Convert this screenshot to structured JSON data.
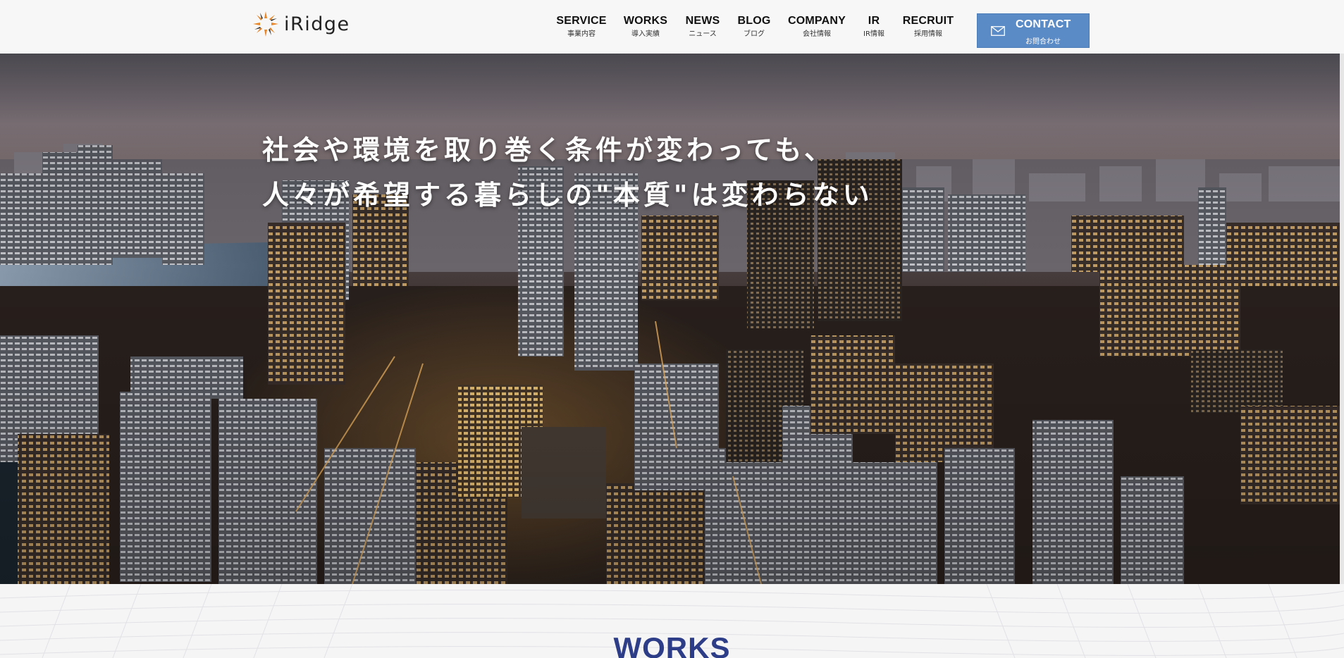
{
  "header": {
    "logo_text": "iRidge",
    "logo_icon": "sunburst-logo-icon",
    "brand_color": "#e8862a",
    "nav": [
      {
        "en": "SERVICE",
        "ja": "事業内容"
      },
      {
        "en": "WORKS",
        "ja": "導入実績"
      },
      {
        "en": "NEWS",
        "ja": "ニュース"
      },
      {
        "en": "BLOG",
        "ja": "ブログ"
      },
      {
        "en": "COMPANY",
        "ja": "会社情報"
      },
      {
        "en": "IR",
        "ja": "IR情報"
      },
      {
        "en": "RECRUIT",
        "ja": "採用情報"
      }
    ],
    "contact": {
      "en": "CONTACT",
      "ja": "お問合わせ",
      "icon": "envelope-icon",
      "color": "#5b8bc6"
    }
  },
  "hero": {
    "line1": "社会や環境を取り巻く条件が変わっても、",
    "line2": "人々が希望する暮らしの\"本質\"は変わらない"
  },
  "works": {
    "title": "WORKS",
    "title_color": "#2d3d87"
  }
}
